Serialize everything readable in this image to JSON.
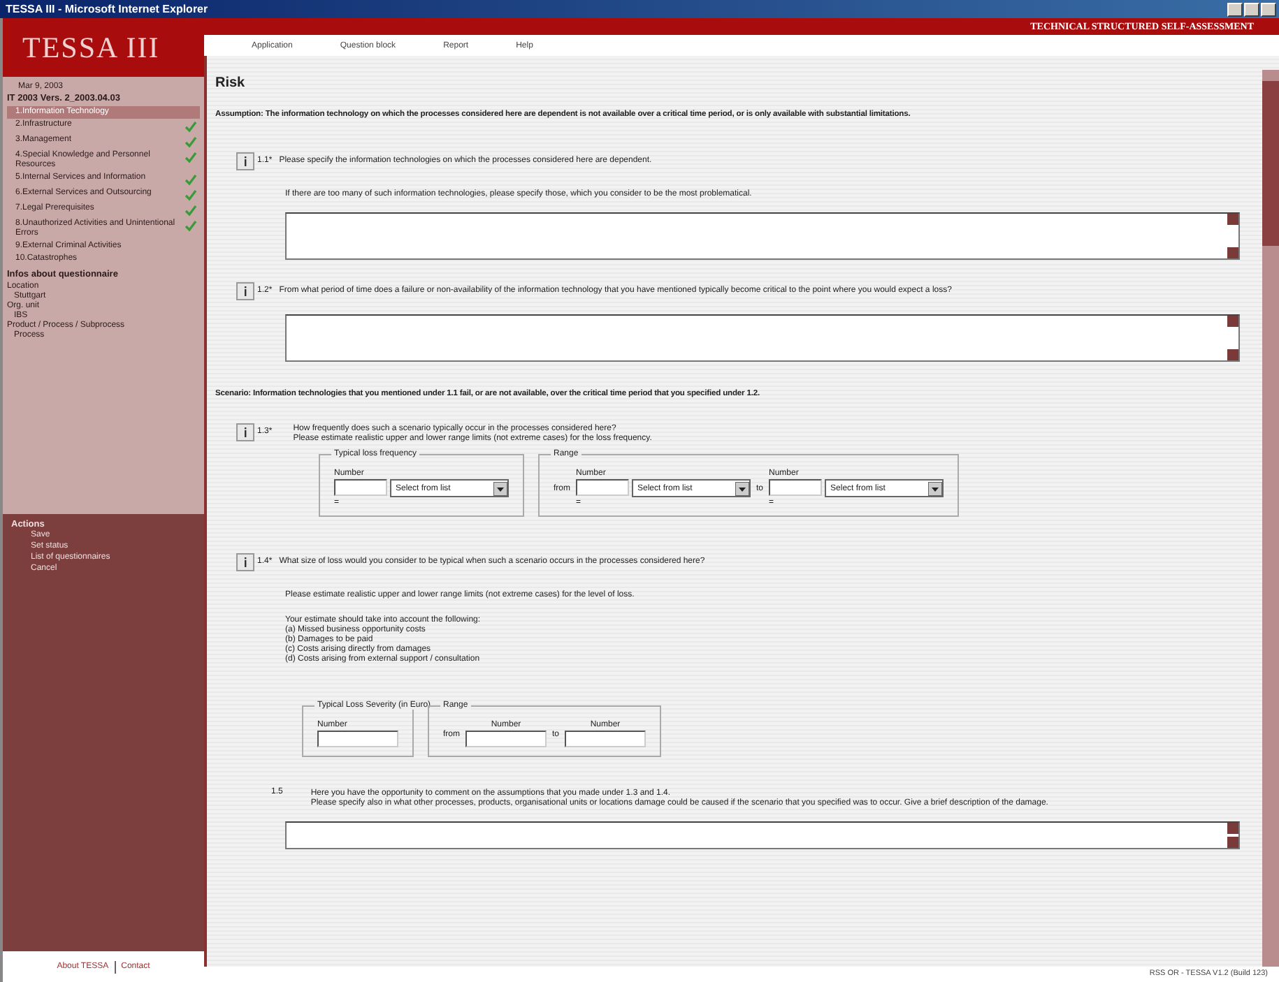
{
  "window": {
    "title": "TESSA III - Microsoft Internet Explorer"
  },
  "app": {
    "logo": "TESSA III",
    "tagline": "TECHNICAL STRUCTURED SELF-ASSESSMENT"
  },
  "menu": [
    "Application",
    "Question block",
    "Report",
    "Help"
  ],
  "sidebar": {
    "date": "Mar 9, 2003",
    "questionnaire": "IT 2003 Vers. 2_2003.04.03",
    "items": [
      {
        "label": "1.Information Technology",
        "selected": true,
        "checked": false
      },
      {
        "label": "2.Infrastructure",
        "selected": false,
        "checked": true
      },
      {
        "label": "3.Management",
        "selected": false,
        "checked": true
      },
      {
        "label": "4.Special Knowledge and Personnel Resources",
        "selected": false,
        "checked": true
      },
      {
        "label": "5.Internal Services and Information",
        "selected": false,
        "checked": true
      },
      {
        "label": "6.External Services and Outsourcing",
        "selected": false,
        "checked": true
      },
      {
        "label": "7.Legal Prerequisites",
        "selected": false,
        "checked": true
      },
      {
        "label": "8.Unauthorized Activities and Unintentional Errors",
        "selected": false,
        "checked": true
      },
      {
        "label": "9.External Criminal Activities",
        "selected": false,
        "checked": false
      },
      {
        "label": "10.Catastrophes",
        "selected": false,
        "checked": false
      }
    ],
    "info_title": "Infos about questionnaire",
    "info": [
      {
        "label": "Location",
        "value": "Stuttgart"
      },
      {
        "label": "Org. unit",
        "value": "IBS"
      },
      {
        "label": "Product / Process / Subprocess",
        "value": "Process"
      }
    ],
    "actions_title": "Actions",
    "actions": [
      "Save",
      "Set status",
      "List of questionnaires",
      "Cancel"
    ],
    "footer": [
      "About TESSA",
      "Contact"
    ]
  },
  "page": {
    "title": "Risk",
    "assumption": "Assumption: The information technology on which the processes considered here are dependent is not available over a critical time period, or is only available with substantial limitations.",
    "q1_1": {
      "number": "1.1*",
      "text": "Please specify the information technologies on which the processes considered here are dependent.",
      "hint": "If there are too many of such information technologies, please specify those, which you consider to be the most problematical."
    },
    "q1_2": {
      "number": "1.2*",
      "text": "From what period of time does a failure or non-availability of the information technology that you have mentioned typically become critical to the point where you would expect a loss?"
    },
    "scenario": "Scenario: Information technologies that you mentioned under 1.1 fail, or are not available, over the critical time period that you specified under 1.2.",
    "q1_3": {
      "number": "1.3*",
      "text": "How frequently does such a scenario typically occur in the processes considered here?",
      "hint": "Please estimate realistic upper and lower range limits (not extreme cases) for the loss frequency.",
      "typical": {
        "legend": "Typical loss frequency",
        "number_label": "Number",
        "select": "Select from list",
        "equals": "="
      },
      "range": {
        "legend": "Range",
        "from": "from",
        "to": "to",
        "cols": [
          {
            "number_label": "Number",
            "select": "Select from list",
            "equals": "="
          },
          {
            "number_label": "Number",
            "select": "Select from list",
            "equals": "="
          }
        ]
      }
    },
    "q1_4": {
      "number": "1.4*",
      "text": "What size of loss would you consider to be typical when such a scenario occurs in the processes considered here?",
      "hint": "Please estimate realistic upper and lower range limits (not extreme cases) for the level of loss.",
      "list_title": "Your estimate should take into account the following:",
      "list": [
        "(a) Missed business opportunity costs",
        "(b) Damages to be paid",
        "(c) Costs arising directly from damages",
        "(d) Costs arising from external support / consultation"
      ],
      "typical": {
        "legend": "Typical Loss Severity (in Euro)",
        "number_label": "Number"
      },
      "range": {
        "legend": "Range",
        "from": "from",
        "to": "to",
        "number_labels": [
          "Number",
          "Number"
        ]
      }
    },
    "q1_5": {
      "number": "1.5",
      "text": "Here you have the opportunity to comment on the assumptions that you made under 1.3 and 1.4.",
      "hint": "Please specify also in what other processes, products, organisational units or locations damage could be caused if the scenario that you specified was to occur. Give a brief description of the damage."
    }
  },
  "status": "RSS OR - TESSA V1.2 (Build 123)"
}
